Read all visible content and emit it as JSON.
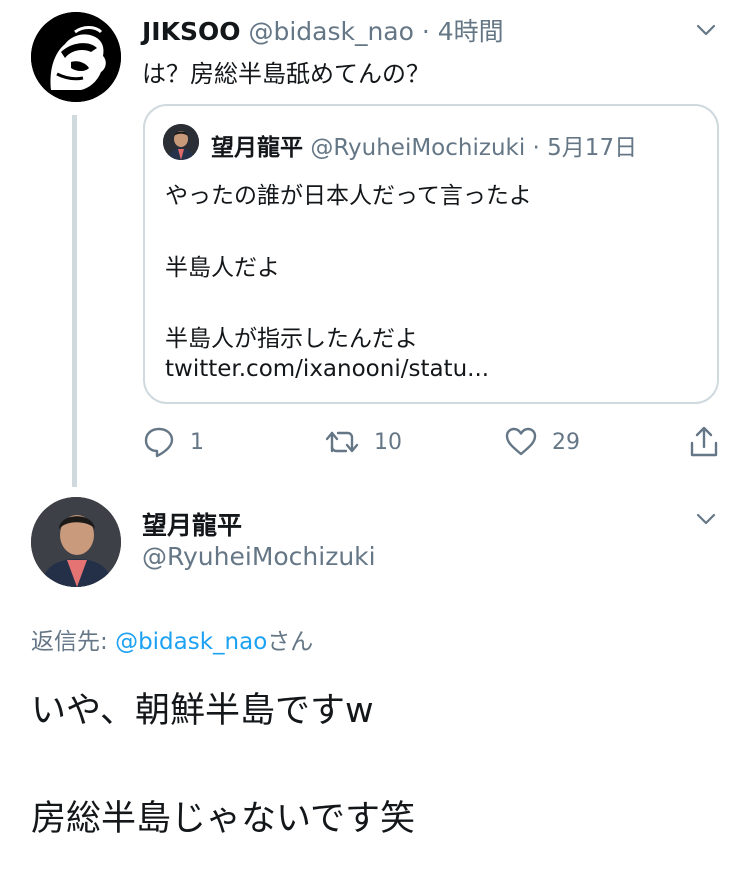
{
  "tweet1": {
    "name": "JIKSOO",
    "handle": "@bidask_nao",
    "separator": "·",
    "time": "4時間",
    "text": "は？房総半島舐めてんの？",
    "quote": {
      "name": "望月龍平",
      "handle": "@RyuheiMochizuki",
      "separator": "·",
      "date": "5月17日",
      "lines": [
        "やったの誰が日本人だって言ったよ",
        "半島人だよ",
        "半島人が指示したんだよ",
        "twitter.com/ixanooni/statu..."
      ]
    },
    "actions": {
      "reply_count": "1",
      "retweet_count": "10",
      "like_count": "29"
    }
  },
  "tweet2": {
    "name": "望月龍平",
    "handle": "@RyuheiMochizuki",
    "reply_prefix": "返信先: ",
    "reply_mention": "@bidask_nao",
    "reply_suffix": "さん",
    "lines": [
      "いや、朝鮮半島ですw",
      "房総半島じゃないです笑"
    ]
  },
  "colors": {
    "primary_text": "#14171a",
    "secondary_text": "#657786",
    "link": "#1da1f2",
    "border": "#cfd9de"
  },
  "icons": [
    "chevron-down-icon",
    "reply-icon",
    "retweet-icon",
    "like-icon",
    "share-icon"
  ]
}
